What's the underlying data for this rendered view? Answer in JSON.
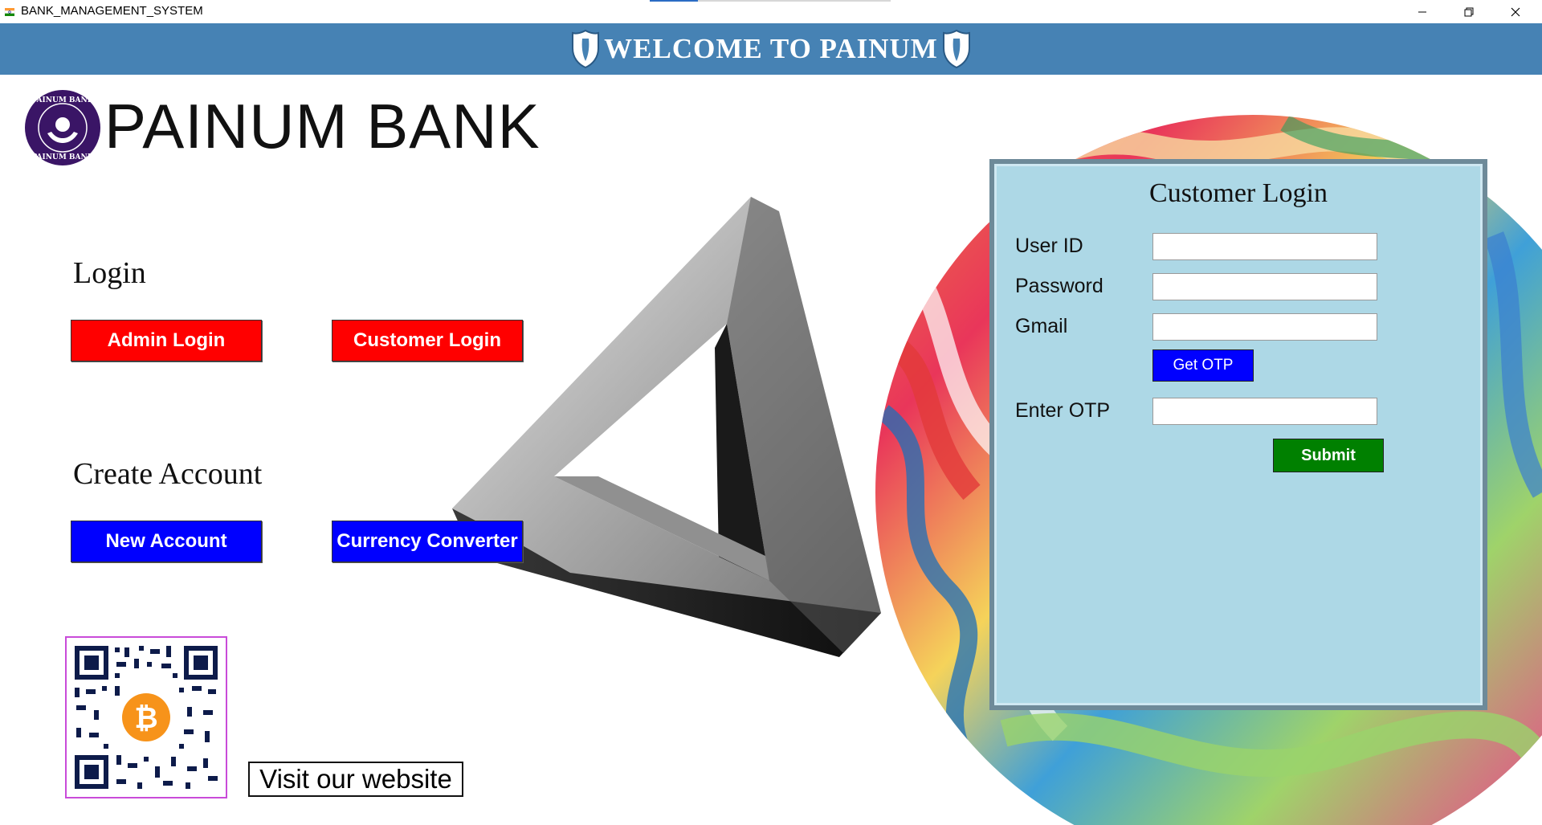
{
  "window": {
    "title": "BANK_MANAGEMENT_SYSTEM",
    "controls": [
      "minimize-icon",
      "restore-icon",
      "close-icon"
    ]
  },
  "header": {
    "title": "WELCOME TO PAINUM",
    "background": "#4682b4"
  },
  "brand": {
    "logo_icon": "bank-seal-icon",
    "name": "PAINUM BANK",
    "seal_color": "#3a1566"
  },
  "login_section": {
    "heading": "Login",
    "admin_button": "Admin Login",
    "customer_button": "Customer Login",
    "button_color": "#ff0000"
  },
  "create_section": {
    "heading": "Create Account",
    "new_account_button": "New Account",
    "currency_button": "Currency Converter",
    "button_color": "#0000ff"
  },
  "qr": {
    "icon": "bitcoin-qr-icon",
    "visit_label": "Visit our website"
  },
  "customer_login": {
    "title": "Customer Login",
    "fields": [
      {
        "label": "User ID",
        "value": ""
      },
      {
        "label": "Password",
        "value": ""
      },
      {
        "label": "Gmail",
        "value": ""
      }
    ],
    "otp_button": "Get OTP",
    "otp_field": {
      "label": "Enter OTP",
      "value": ""
    },
    "submit_button": "Submit",
    "panel_color": "#add8e6"
  }
}
